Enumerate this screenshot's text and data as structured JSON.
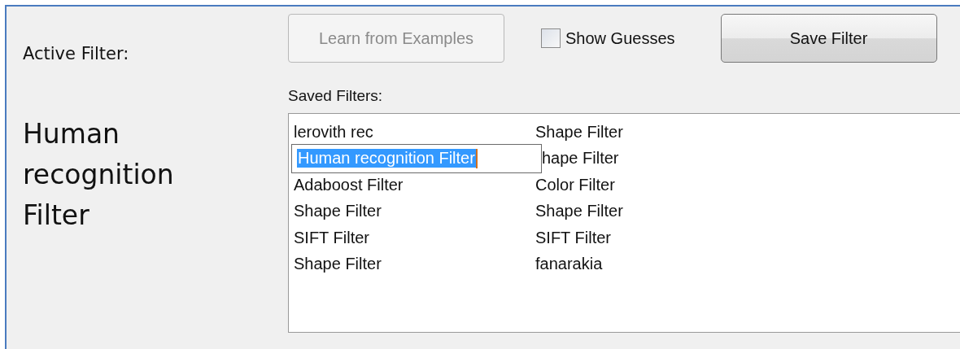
{
  "active_filter": {
    "label": "Active Filter:",
    "name": "Human recognition Filter"
  },
  "learn_button": {
    "label": "Learn from Examples",
    "disabled": true
  },
  "show_guesses": {
    "label": "Show Guesses",
    "checked": false
  },
  "save_button": {
    "label": "Save Filter"
  },
  "saved_filters": {
    "label": "Saved Filters:",
    "rows": [
      {
        "column_1": "lerovith rec",
        "column_2": "Shape Filter",
        "editing": false
      },
      {
        "column_1": "Human recognition Filter",
        "column_2": "hape Filter",
        "editing": true
      },
      {
        "column_1": "Adaboost Filter",
        "column_2": "Color Filter",
        "editing": false
      },
      {
        "column_1": "Shape Filter",
        "column_2": "Shape Filter",
        "editing": false
      },
      {
        "column_1": "SIFT Filter",
        "column_2": "SIFT Filter",
        "editing": false
      },
      {
        "column_1": "Shape Filter",
        "column_2": "fanarakia",
        "editing": false
      }
    ]
  }
}
